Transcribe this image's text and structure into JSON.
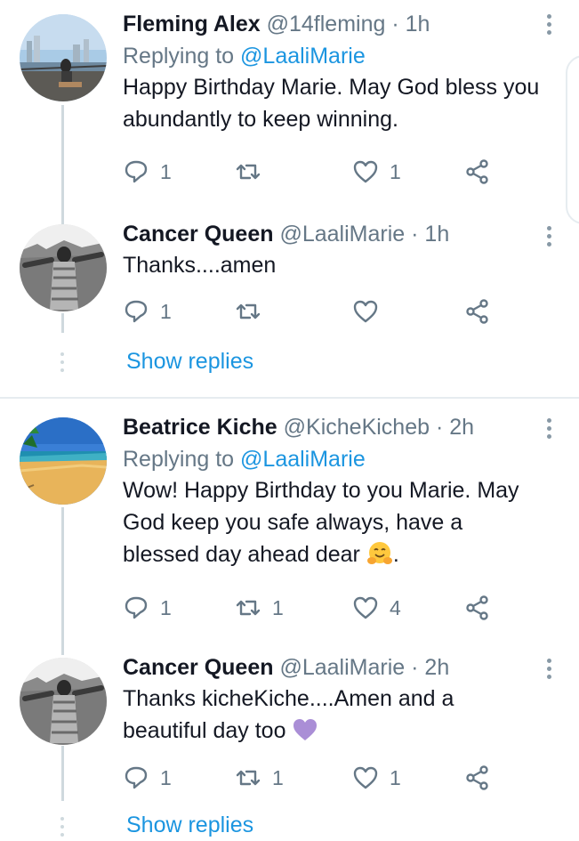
{
  "tweets": [
    {
      "name": "Fleming Alex",
      "handle": "@14fleming",
      "time": "· 1h",
      "reply_prefix": "Replying to ",
      "reply_to": "@LaaliMarie",
      "text": "Happy Birthday Marie. May God bless you abundantly to keep winning.",
      "replies": "1",
      "retweets": "",
      "likes": "1",
      "avatar": "city-waterfront-photo"
    },
    {
      "name": "Cancer Queen",
      "handle": "@LaaliMarie",
      "time": "· 1h",
      "text": "Thanks....amen",
      "replies": "1",
      "retweets": "",
      "likes": "",
      "avatar": "bw-woman-arms-outstretched-photo",
      "show_replies": "Show replies"
    },
    {
      "name": "Beatrice Kiche",
      "handle": "@KicheKicheb",
      "time": "· 2h",
      "reply_prefix": "Replying to ",
      "reply_to": "@LaaliMarie",
      "text_line1": "Wow! Happy Birthday to you Marie. May",
      "text_line2": "God keep you safe always, have a",
      "text_line3": "blessed day ahead dear",
      "text_end": ".",
      "emoji": "hugging-face-emoji",
      "replies": "1",
      "retweets": "1",
      "likes": "4",
      "avatar": "beach-photo"
    },
    {
      "name": "Cancer Queen",
      "handle": "@LaaliMarie",
      "time": "· 2h",
      "text_line1": "Thanks kicheKiche....Amen and a",
      "text_line2": "beautiful day too",
      "emoji": "purple-heart-emoji",
      "replies": "1",
      "retweets": "1",
      "likes": "1",
      "avatar": "bw-woman-arms-outstretched-photo",
      "show_replies": "Show replies"
    }
  ],
  "colors": {
    "link": "#1b95e0",
    "secondary": "#657786",
    "thread_line": "#cfd9de"
  }
}
